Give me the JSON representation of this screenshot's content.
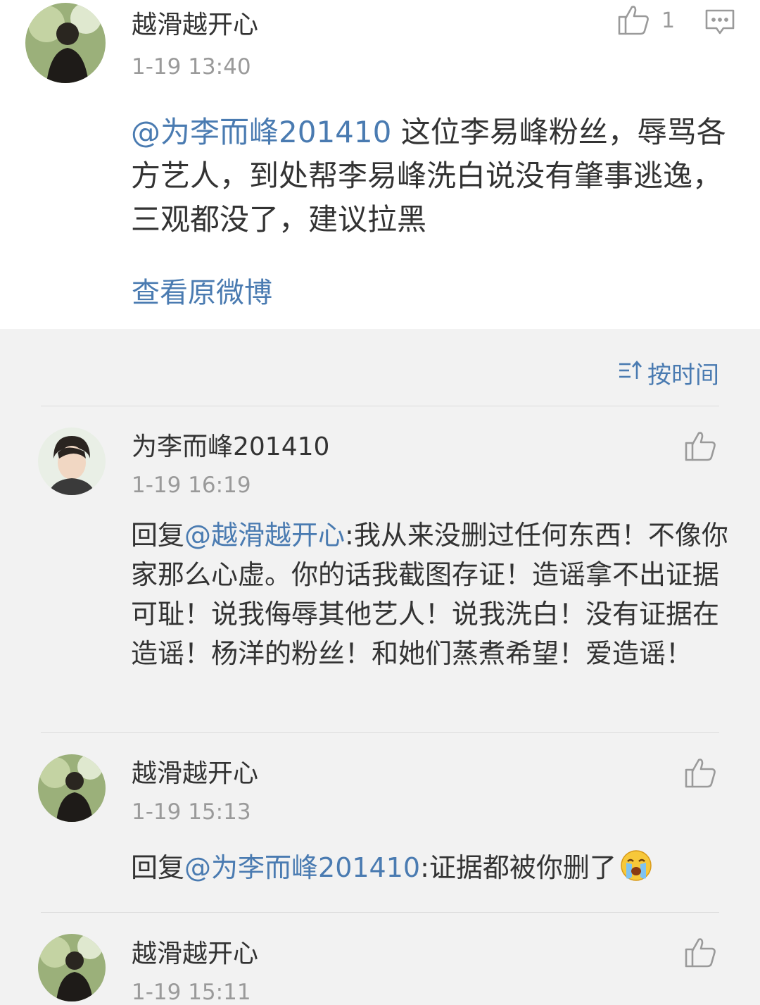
{
  "main_comment": {
    "author": "越滑越开心",
    "time": "1-19 13:40",
    "likes": "1",
    "mention": "@为李而峰201410",
    "text": " 这位李易峰粉丝，辱骂各方艺人，到处帮李易峰洗白说没有肇事逃逸，三观都没了，建议拉黑",
    "view_original": "查看原微博"
  },
  "sort": {
    "label": "按时间",
    "icon": "sort-icon"
  },
  "replies": [
    {
      "author": "为李而峰201410",
      "time": "1-19 16:19",
      "prefix": "回复",
      "mention": "@越滑越开心",
      "text": ":我从来没删过任何东西！不像你家那么心虚。你的话我截图存证！造谣拿不出证据可耻！说我侮辱其他艺人！说我洗白！没有证据在造谣！杨洋的粉丝！和她们蒸煮希望！爱造谣！"
    },
    {
      "author": "越滑越开心",
      "time": "1-19 15:13",
      "prefix": "回复",
      "mention": "@为李而峰201410",
      "text": ":证据都被你删了",
      "emoji": "crying-face"
    },
    {
      "author": "越滑越开心",
      "time": "1-19 15:11"
    }
  ],
  "colors": {
    "link": "#4a7bb1",
    "background": "#f2f2f2",
    "card": "#ffffff"
  }
}
